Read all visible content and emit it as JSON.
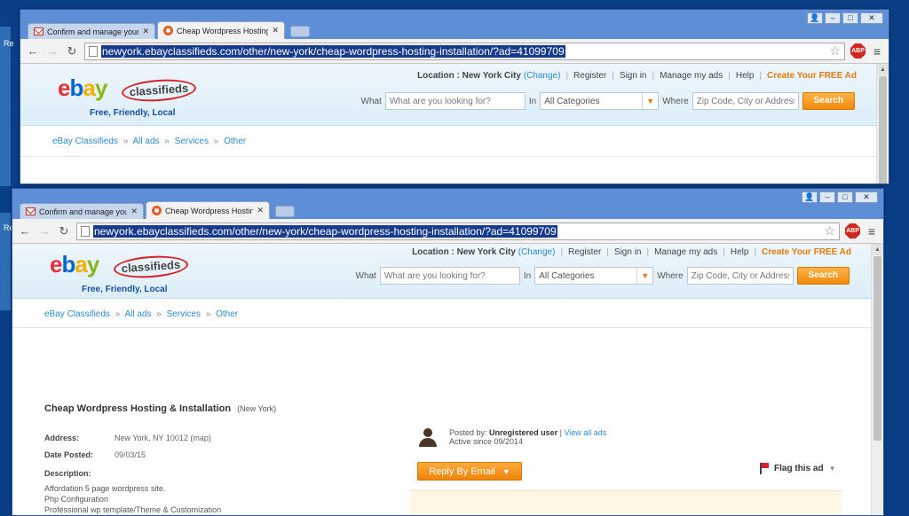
{
  "desktop": {
    "labels": [
      "Re",
      "Re"
    ]
  },
  "window_controls": {
    "account": "👤",
    "minimize": "–",
    "maximize": "□",
    "close": "✕"
  },
  "browser": {
    "tabs": [
      {
        "title": "Confirm and manage your ac",
        "icon": "gmail-icon",
        "close": "✕"
      },
      {
        "title": "Cheap Wordpress Hosting &",
        "icon": "ebay-favicon",
        "close": "✕"
      }
    ],
    "nav": {
      "back": "←",
      "forward": "→",
      "reload": "↻"
    },
    "url": "newyork.ebayclassifieds.com/other/new-york/cheap-wordpress-hosting-installation/?ad=41099709",
    "star": "☆",
    "abp_label": "ABP",
    "abp_count": "4",
    "menu": "≡"
  },
  "site": {
    "logo": {
      "e": "e",
      "b": "b",
      "a": "a",
      "y": "y",
      "classifieds": "classifieds",
      "tagline": "Free, Friendly, Local"
    },
    "toplinks": {
      "location_label": "Location : New York City",
      "change_open": "(",
      "change": "Change",
      "change_close": ")",
      "register": "Register",
      "sign_in": "Sign in",
      "manage": "Manage my ads",
      "help": "Help",
      "create": "Create Your FREE Ad",
      "sep": "|"
    },
    "search": {
      "what_label": "What",
      "what_placeholder": "What are you looking for?",
      "in_label": "In",
      "category": "All Categories",
      "category_arrow": "▼",
      "where_label": "Where",
      "where_placeholder": "Zip Code, City or Address",
      "button": "Search"
    },
    "breadcrumbs": [
      "eBay Classifieds",
      "All ads",
      "Services",
      "Other"
    ],
    "crumb_sep": "»"
  },
  "listing": {
    "title": "Cheap Wordpress Hosting & Installation",
    "location": "(New York)",
    "address_label": "Address:",
    "address_value": "New York, NY 10012 (map)",
    "date_label": "Date Posted:",
    "date_value": "09/03/15",
    "description_label": "Description:",
    "description_lines": [
      "Affordation 5 page wordpress site.",
      "Php Configuration",
      "Professional wp template/Theme & Customization"
    ],
    "posted_by_label": "Posted by:",
    "poster": "Unregistered user",
    "poster_sep": "|",
    "view_all": "View all ads",
    "active_since": "Active since 09/2014",
    "reply_button": "Reply By Email",
    "reply_arrow": "▼",
    "flag": "Flag this ad",
    "flag_caret": "▼"
  },
  "colors": {
    "desktop": "#0a3f86",
    "window_frame": "#5d8ed6",
    "accent_orange": "#f08a0c",
    "link_blue": "#2a8ccf",
    "url_highlight": "#163a8c"
  }
}
